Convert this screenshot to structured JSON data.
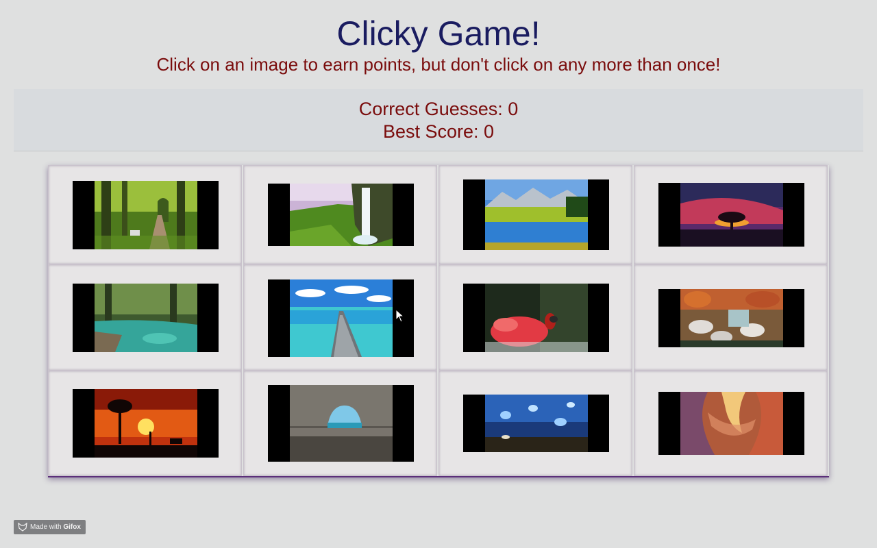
{
  "header": {
    "title": "Clicky Game!",
    "subtitle": "Click on an image to earn points, but don't click on any more than once!"
  },
  "score": {
    "correct_label": "Correct Guesses: 0",
    "best_label": "Best Score: 0"
  },
  "cards": [
    {
      "name": "forest-path"
    },
    {
      "name": "waterfall"
    },
    {
      "name": "mountain-lake"
    },
    {
      "name": "red-sky-tree"
    },
    {
      "name": "forest-river"
    },
    {
      "name": "pier-ocean"
    },
    {
      "name": "bird-on-flowers"
    },
    {
      "name": "rock-waterfall"
    },
    {
      "name": "savanna-sunset"
    },
    {
      "name": "sea-cave"
    },
    {
      "name": "blue-butterflies"
    },
    {
      "name": "canyon"
    }
  ],
  "badge": {
    "prefix": "Made with",
    "brand": "Gifox",
    "icon": "fox-icon"
  }
}
